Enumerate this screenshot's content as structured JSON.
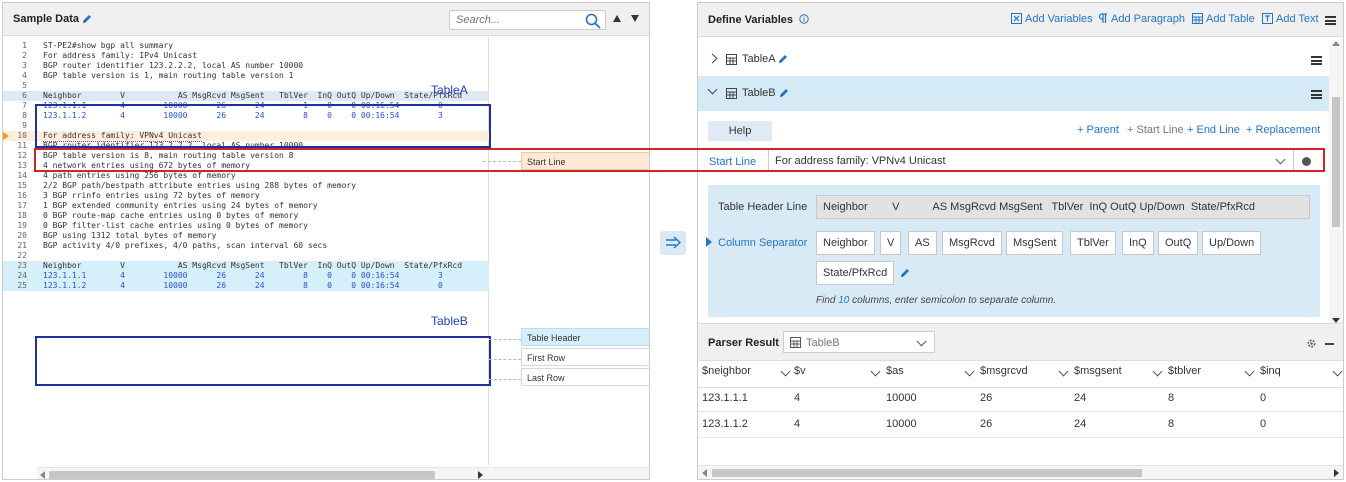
{
  "sample_data": {
    "title": "Sample Data",
    "search_placeholder": "Search...",
    "code_lines": [
      {
        "n": "1",
        "text": "ST-PE2#show bgp all summary"
      },
      {
        "n": "2",
        "text": "For address family: IPv4 Unicast"
      },
      {
        "n": "3",
        "text": "BGP router identifier 123.2.2.2, local AS number 10000"
      },
      {
        "n": "4",
        "text": "BGP table version is 1, main routing table version 1"
      },
      {
        "n": "5",
        "text": ""
      },
      {
        "n": "6",
        "text": "Neighbor        V           AS MsgRcvd MsgSent   TblVer  InQ OutQ Up/Down  State/PfxRcd"
      },
      {
        "n": "7",
        "text": "123.1.1.1       4        10000      26      24        1    0    0 00:16:54        0"
      },
      {
        "n": "8",
        "text": "123.1.1.2       4        10000      26      24        8    0    0 00:16:54        3"
      },
      {
        "n": "9",
        "text": ""
      },
      {
        "n": "10",
        "text": "For address family: VPNv4 Unicast"
      },
      {
        "n": "11",
        "text": "BGP router identifier 123.2.2.2, local AS number 10000"
      },
      {
        "n": "12",
        "text": "BGP table version is 8, main routing table version 8"
      },
      {
        "n": "13",
        "text": "4 network entries using 672 bytes of memory"
      },
      {
        "n": "14",
        "text": "4 path entries using 256 bytes of memory"
      },
      {
        "n": "15",
        "text": "2/2 BGP path/bestpath attribute entries using 288 bytes of memory"
      },
      {
        "n": "16",
        "text": "3 BGP rrinfo entries using 72 bytes of memory"
      },
      {
        "n": "17",
        "text": "1 BGP extended community entries using 24 bytes of memory"
      },
      {
        "n": "18",
        "text": "0 BGP route-map cache entries using 0 bytes of memory"
      },
      {
        "n": "19",
        "text": "0 BGP filter-list cache entries using 0 bytes of memory"
      },
      {
        "n": "20",
        "text": "BGP using 1312 total bytes of memory"
      },
      {
        "n": "21",
        "text": "BGP activity 4/0 prefixes, 4/0 paths, scan interval 60 secs"
      },
      {
        "n": "22",
        "text": ""
      },
      {
        "n": "23",
        "text": "Neighbor        V           AS MsgRcvd MsgSent   TblVer  InQ OutQ Up/Down  State/PfxRcd"
      },
      {
        "n": "24",
        "text": "123.1.1.1       4        10000      26      24        8    0    0 00:16:54        3"
      },
      {
        "n": "25",
        "text": "123.1.1.2       4        10000      26      24        8    0    0 00:16:54        0"
      }
    ],
    "table_a_label": "TableA",
    "table_b_label": "TableB",
    "tags": {
      "start_line": "Start Line",
      "table_header": "Table Header",
      "first_row": "First Row",
      "last_row": "Last Row"
    }
  },
  "define_variables": {
    "title": "Define Variables",
    "actions": {
      "add_variables": "Add Variables",
      "add_paragraph": "Add Paragraph",
      "add_table": "Add Table",
      "add_text": "Add Text"
    },
    "tables": [
      "TableA",
      "TableB"
    ],
    "help_label": "Help",
    "links": {
      "parent": "+ Parent",
      "start_line": "+ Start Line",
      "end_line": "+ End Line",
      "replacement": "+ Replacement"
    },
    "start_line_label": "Start Line",
    "start_line_value": "For address family: VPNv4 Unicast",
    "table_header_line_label": "Table Header Line",
    "table_header_line_value": "Neighbor        V           AS MsgRcvd MsgSent   TblVer  InQ OutQ Up/Down  State/PfxRcd",
    "column_separator_label": "Column Separator",
    "columns": [
      "Neighbor",
      "V",
      "AS",
      "MsgRcvd",
      "MsgSent",
      "TblVer",
      "InQ",
      "OutQ",
      "Up/Down",
      "State/PfxRcd"
    ],
    "find_prefix": "Find",
    "find_count": "10",
    "find_suffix": "columns, enter semicolon to separate column."
  },
  "parser_result": {
    "title": "Parser Result",
    "selected_table": "TableB",
    "headers": [
      "$neighbor",
      "$v",
      "$as",
      "$msgrcvd",
      "$msgsent",
      "$tblver",
      "$inq"
    ],
    "rows": [
      [
        "123.1.1.1",
        "4",
        "10000",
        "26",
        "24",
        "8",
        "0"
      ],
      [
        "123.1.1.2",
        "4",
        "10000",
        "26",
        "24",
        "8",
        "0"
      ]
    ]
  },
  "colors": {
    "accent_blue": "#2674c8",
    "table_box": "#1e2fa0",
    "highlight_red": "#d0242b",
    "row_selected": "#d4ebf7"
  }
}
